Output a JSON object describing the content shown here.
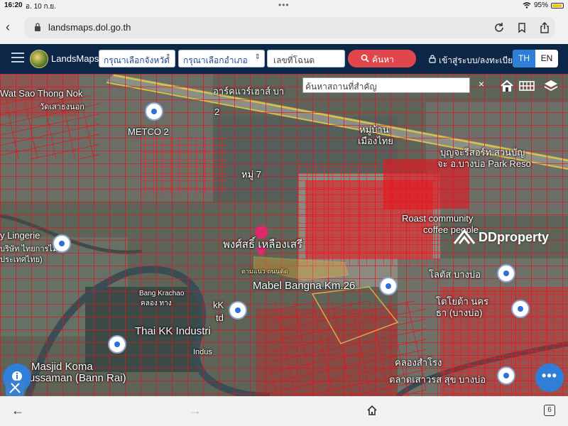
{
  "status": {
    "time": "16:20",
    "date": "อ. 10 ก.ย.",
    "dots": "•••",
    "battery": "95%"
  },
  "browser": {
    "url": "landsmaps.dol.go.th"
  },
  "header": {
    "app_name": "LandsMaps",
    "province_select": "กรุณาเลือกจังหวัด",
    "district_select": "กรุณาเลือกอำเภอ",
    "deed_placeholder": "เลขที่โฉนด",
    "search_label": "ค้นหา",
    "login_label": "เข้าสู่ระบบ/ลงทะเบียน",
    "lang_th": "TH",
    "lang_en": "EN"
  },
  "map": {
    "place_search_placeholder": "ค้นหาสถานที่สำคัญ",
    "close_symbol": "×",
    "labels": {
      "wat": "Wat Sao Thong Nok",
      "wat_th": "วัดเสาธงนอก",
      "metco": "METCO 2",
      "num2": "2",
      "moo7": "หมู่ 7",
      "rama": "อาร์คแวร์เฮาส์ บา",
      "moobaan": "หมู่บ้าน",
      "muangthai": "เมืองไทย",
      "boonchu": "บุญจะรีสอร์ท สวนบัญ",
      "boonchu2": "จะ อ.บางบ่อ Park Reso",
      "roast": "Roast community",
      "coffee": "coffee people",
      "lingerie": "y Lingerie",
      "lingerie2": "บริษัท ไทยการไม่",
      "lingerie3": "ประเทศไทย)",
      "owner": "พงศ์สธิ์ เหลืองเสรี",
      "parcel": "ตามแนว ถนนตัด",
      "mabel": "Mabel Bangna Km.26",
      "lotus": "โลตัส บางบ่อ",
      "toyota": "โตโยต้า นคร",
      "toyota2": "ธา (บางบ่อ)",
      "bang": "Bang Krachao",
      "bang2": "คลอง ทาง",
      "thaikk": "Thai KK Industri",
      "kk": "kK",
      "ltd": "td",
      "indus": "Indus",
      "masjid": "Masjid Koma",
      "russaman": "Russaman (Bann Rai)",
      "market": "ตลาดเสาวรส สุข บางบ่อ",
      "market2": "คลองสำโรง"
    },
    "watermark": "DDproperty",
    "more_button": "•••"
  },
  "bottom": {
    "tab_count": "6"
  }
}
